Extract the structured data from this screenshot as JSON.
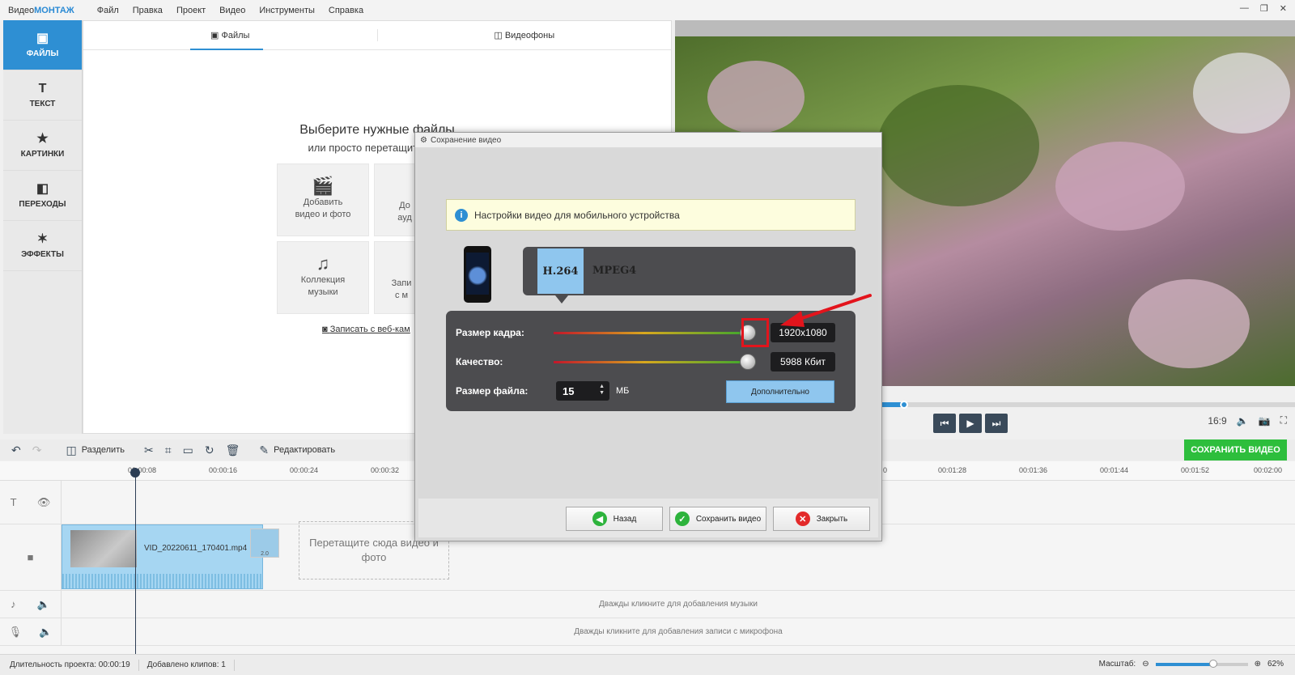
{
  "app": {
    "title_prefix": "Видео",
    "title_brand": "МОНТАЖ",
    "window_controls": [
      "—",
      "❐",
      "✕"
    ]
  },
  "menu": [
    "Файл",
    "Правка",
    "Проект",
    "Видео",
    "Инструменты",
    "Справка"
  ],
  "sidebar": [
    {
      "label": "ФАЙЛЫ",
      "icon": "image-icon",
      "glyph": "▣"
    },
    {
      "label": "ТЕКСТ",
      "icon": "text-icon",
      "glyph": "T"
    },
    {
      "label": "КАРТИНКИ",
      "icon": "star-icon",
      "glyph": "★"
    },
    {
      "label": "ПЕРЕХОДЫ",
      "icon": "transitions-icon",
      "glyph": "◧"
    },
    {
      "label": "ЭФФЕКТЫ",
      "icon": "wand-icon",
      "glyph": "✶"
    }
  ],
  "files_panel": {
    "tabs": [
      "Файлы",
      "Видеофоны"
    ],
    "title": "Выберите нужные файлы",
    "subtitle": "или просто перетащите их и",
    "tiles": [
      {
        "label": "Добавить видео и фото",
        "icon": "clapper-icon"
      },
      {
        "label": "До ауд",
        "icon": "audio-icon"
      },
      {
        "label": "Коллекция музыки",
        "icon": "music-notes-icon"
      },
      {
        "label": "Запи с м",
        "icon": "record-icon"
      }
    ],
    "webcam_link": "Записать с веб-кам"
  },
  "player": {
    "aspect": "16:9",
    "progress_fraction": 0.37
  },
  "toolbar": {
    "split": "Разделить",
    "edit": "Редактировать",
    "save_video": "СОХРАНИТЬ ВИДЕО"
  },
  "timeline": {
    "ticks_left": [
      "00:00:08",
      "00:00:16",
      "00:00:24",
      "00:00:32"
    ],
    "ticks_right": [
      "0",
      "00:01:28",
      "00:01:36",
      "00:01:44",
      "00:01:52",
      "00:02:00"
    ],
    "clip_name": "VID_20220611_170401.mp4",
    "clip_badge": "2.0",
    "drop_hint": "Перетащите сюда видео и фото",
    "music_hint": "Дважды кликните для добавления музыки",
    "mic_hint": "Дважды кликните для добавления записи с микрофона"
  },
  "status": {
    "duration": "Длительность проекта:  00:00:19",
    "clips": "Добавлено клипов: 1",
    "zoom_label": "Масштаб:",
    "zoom_value": "62%"
  },
  "dialog": {
    "title": "Сохранение видео",
    "info": "Настройки видео для мобильного устройства",
    "codec": "H.264",
    "container": "MPEG4",
    "frame_label": "Размер кадра:",
    "frame_value": "1920x1080",
    "frame_fraction": 1.0,
    "quality_label": "Качество:",
    "quality_value": "5988 Кбит",
    "quality_fraction": 1.0,
    "size_label": "Размер файла:",
    "size_value": "15",
    "size_unit": "МБ",
    "advanced": "Дополнительно",
    "back": "Назад",
    "save": "Сохранить видео",
    "close": "Закрыть",
    "colors": {
      "highlight": "#e3141c",
      "accent": "#8fc6ee"
    }
  }
}
